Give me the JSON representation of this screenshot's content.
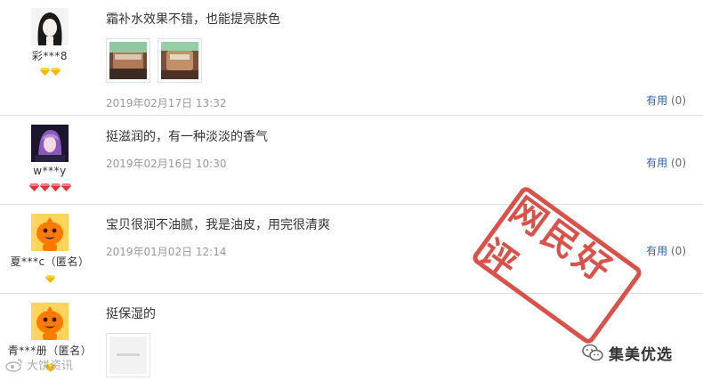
{
  "reviews": [
    {
      "user": "彩***8",
      "avatar": "girl-avatar",
      "badges": [
        "diamond-yellow",
        "diamond-yellow"
      ],
      "text": "霜补水效果不错，也能提亮肤色",
      "images": [
        "product-photo-1",
        "product-photo-2"
      ],
      "date": "2019年02月17日 13:32",
      "useful_label": "有用",
      "useful_count": "(0)"
    },
    {
      "user": "w***y",
      "avatar": "purple-hair-avatar",
      "badges": [
        "diamond-red",
        "diamond-red",
        "diamond-red",
        "diamond-red"
      ],
      "text": "挺滋润的，有一种淡淡的香气",
      "images": [],
      "date": "2019年02月16日 10:30",
      "useful_label": "有用",
      "useful_count": "(0)"
    },
    {
      "user": "夏***c（匿名）",
      "avatar": "orange-mascot-avatar",
      "badges": [
        "diamond-yellow"
      ],
      "text": "宝贝很润不油腻，我是油皮，用完很清爽",
      "images": [],
      "date": "2019年01月02日 12:14",
      "useful_label": "有用",
      "useful_count": "(0)"
    },
    {
      "user": "青***册（匿名）",
      "avatar": "orange-mascot-avatar",
      "badges": [
        "diamond-yellow"
      ],
      "text": "挺保湿的",
      "images": [
        "placeholder-photo"
      ],
      "date": "",
      "useful_label": "",
      "useful_count": ""
    }
  ],
  "stamp": {
    "text": "网民好评",
    "color": "#d63a32"
  },
  "watermark_right": {
    "icon": "wechat-icon",
    "text": "集美优选"
  },
  "watermark_left": {
    "icon": "weibo-icon",
    "text": "大饼资讯"
  },
  "colors": {
    "link_blue": "#2f64b4",
    "date_gray": "#999999",
    "divider": "#dcdcdc"
  }
}
